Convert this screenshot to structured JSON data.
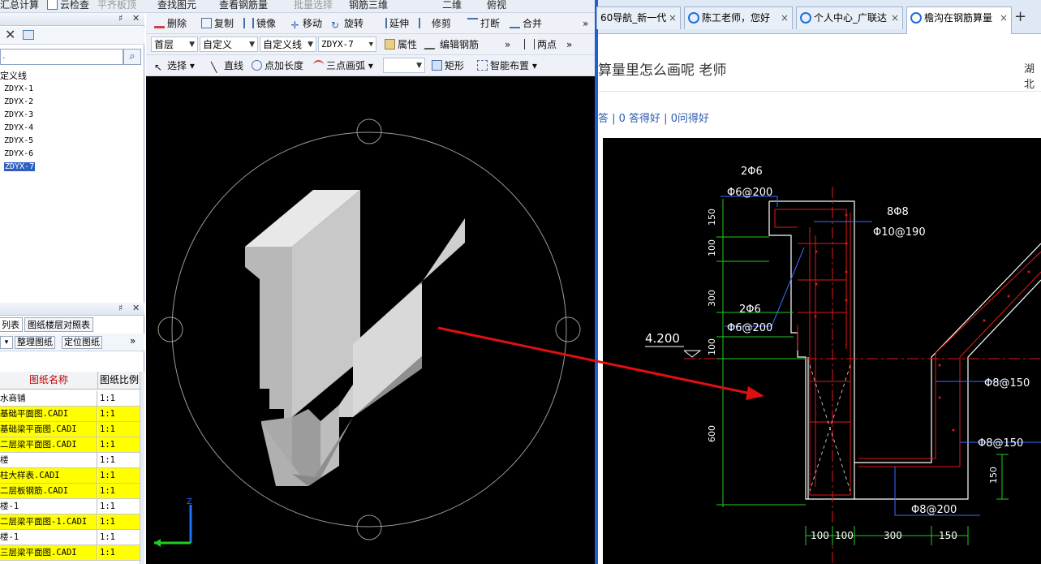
{
  "app": {
    "top_strip": [
      "汇总计算",
      "云检查",
      "平齐板顶",
      "查找图元",
      "查看钢筋量",
      "批量选择",
      "钢筋三维",
      "二维",
      "俯视"
    ],
    "layer_panel": {
      "search_placeholder": "",
      "tree_root": "定义线",
      "items": [
        "ZDYX-1",
        "ZDYX-2",
        "ZDYX-3",
        "ZDYX-4",
        "ZDYX-5",
        "ZDYX-6",
        "ZDYX-7"
      ],
      "selected_index": 6
    },
    "drawing_panel": {
      "tabs": [
        "列表",
        "图纸楼层对照表"
      ],
      "buttons": [
        "整理图纸",
        "定位图纸"
      ],
      "headers": [
        "图纸名称",
        "图纸比例"
      ],
      "rows": [
        {
          "name": "水商铺",
          "scale": "1:1",
          "yellow": false
        },
        {
          "name": "基础平面图.CADI",
          "scale": "1:1",
          "yellow": true
        },
        {
          "name": "基础梁平面图.CADI",
          "scale": "1:1",
          "yellow": true
        },
        {
          "name": "二层梁平面图.CADI",
          "scale": "1:1",
          "yellow": true
        },
        {
          "name": "楼",
          "scale": "1:1",
          "yellow": false
        },
        {
          "name": "柱大样表.CADI",
          "scale": "1:1",
          "yellow": true
        },
        {
          "name": "二层板钢筋.CADI",
          "scale": "1:1",
          "yellow": true
        },
        {
          "name": "楼-1",
          "scale": "1:1",
          "yellow": false
        },
        {
          "name": "二层梁平面图-1.CADI",
          "scale": "1:1",
          "yellow": true
        },
        {
          "name": "楼-1",
          "scale": "1:1",
          "yellow": false
        },
        {
          "name": "三层梁平面图.CADI",
          "scale": "1:1",
          "yellow": true
        }
      ]
    },
    "toolbar": {
      "row1": [
        "删除",
        "复制",
        "镜像",
        "移动",
        "旋转",
        "延伸",
        "修剪",
        "打断",
        "合并"
      ],
      "floor": "首层",
      "category": "自定义",
      "type": "自定义线",
      "element": "ZDYX-7",
      "property": "属性",
      "edit_rebar": "编辑钢筋",
      "two_points": "两点",
      "select": "选择",
      "line": "直线",
      "point_length": "点加长度",
      "arc": "三点画弧",
      "rect": "矩形",
      "smart_place": "智能布置",
      "more": "»"
    },
    "axis_label": "Z"
  },
  "browser": {
    "tabs": [
      "60导航_新一代",
      "陈工老师，您好",
      "个人中心_广联达",
      "檐沟在钢筋算量"
    ],
    "active_tab": 3,
    "question_title": "算量里怎么画呢 老师",
    "side_text": "湖北",
    "stats": "答 | 0 答得好 | 0问得好",
    "drawing_labels": {
      "top_bars": "2Φ6",
      "top_stirrup": "Φ6@200",
      "mid_bars": "8Φ8",
      "mid_stirrup": "Φ10@190",
      "left_bars": "2Φ6",
      "left_stirrup": "Φ6@200",
      "elevation": "4.200",
      "slope_rebar": "Φ8@150",
      "bottom_rebar1": "Φ8@150",
      "bottom_rebar2": "Φ8@200",
      "dims_vertical": [
        "150",
        "100",
        "300",
        "100",
        "600"
      ],
      "dims_bottom": [
        "100",
        "100",
        "300",
        "150"
      ],
      "dim_right": "150"
    }
  },
  "colors": {
    "accent": "#1f5fd1",
    "highlight": "#ffff00",
    "arrow": "#e01010"
  }
}
